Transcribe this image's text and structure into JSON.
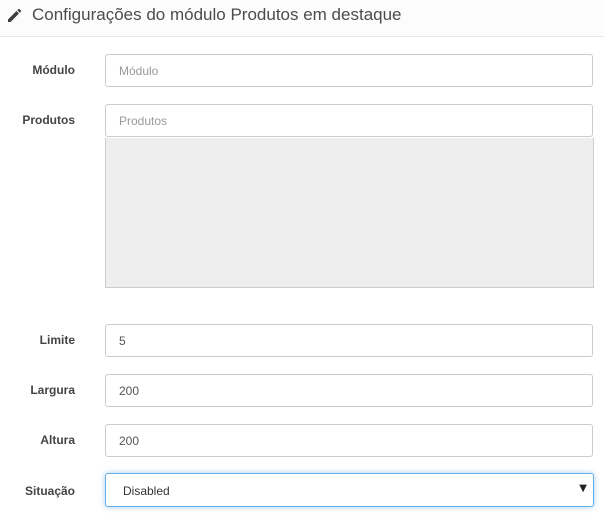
{
  "header": {
    "title": "Configurações do módulo Produtos em destaque",
    "icon": "pencil-icon"
  },
  "form": {
    "module": {
      "label": "Módulo",
      "value": "",
      "placeholder": "Módulo"
    },
    "products": {
      "label": "Produtos",
      "value": "",
      "placeholder": "Produtos",
      "selected_items": []
    },
    "limit": {
      "label": "Limite",
      "value": "5"
    },
    "width": {
      "label": "Largura",
      "value": "200"
    },
    "height": {
      "label": "Altura",
      "value": "200"
    },
    "status": {
      "label": "Situação",
      "value": "Disabled",
      "options": [
        "Disabled"
      ]
    }
  },
  "colors": {
    "focus_border": "#66afe9",
    "list_background": "#eeeeee"
  }
}
